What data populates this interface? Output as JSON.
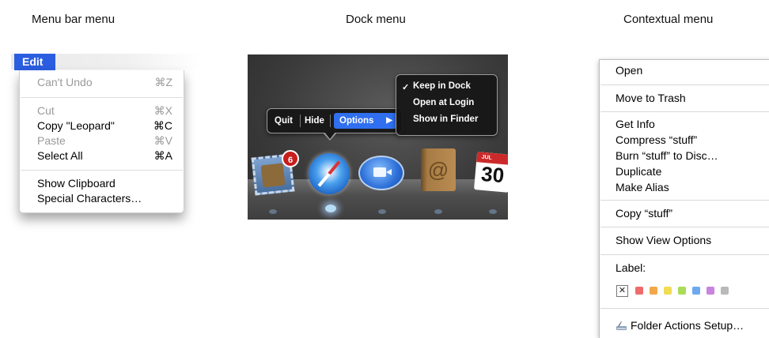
{
  "titles": {
    "menubar": "Menu bar menu",
    "dock": "Dock menu",
    "context": "Contextual menu"
  },
  "menubar_menu": {
    "title": "Edit",
    "items": [
      {
        "label": "Can't Undo",
        "shortcut": "⌘Z",
        "enabled": false
      },
      {
        "label": "Cut",
        "shortcut": "⌘X",
        "enabled": false
      },
      {
        "label": "Copy \"Leopard\"",
        "shortcut": "⌘C",
        "enabled": true
      },
      {
        "label": "Paste",
        "shortcut": "⌘V",
        "enabled": false
      },
      {
        "label": "Select All",
        "shortcut": "⌘A",
        "enabled": true
      },
      {
        "label": "Show Clipboard",
        "shortcut": "",
        "enabled": true
      },
      {
        "label": "Special Characters…",
        "shortcut": "",
        "enabled": true
      }
    ]
  },
  "dock_menu": {
    "buttons": [
      "Quit",
      "Hide",
      "Options"
    ],
    "options_arrow": "▶",
    "submenu": {
      "check": "✓",
      "items": [
        "Keep in Dock",
        "Open at Login",
        "Show in Finder"
      ]
    },
    "mail_badge": "6",
    "calendar": {
      "month": "JUL",
      "day": "30"
    },
    "address_book_symbol": "@"
  },
  "context_menu": {
    "items": [
      "Open",
      "Move to Trash",
      "Get Info",
      "Compress “stuff”",
      "Burn “stuff” to Disc…",
      "Duplicate",
      "Make Alias",
      "Copy “stuff”",
      "Show View Options",
      "Label:",
      "Folder Actions Setup…"
    ],
    "label_none": "✕",
    "label_colors": [
      "#ef6b6b",
      "#f2a84a",
      "#f0dc55",
      "#a9dc58",
      "#6da9f0",
      "#c983e0",
      "#b9b9b9"
    ]
  }
}
